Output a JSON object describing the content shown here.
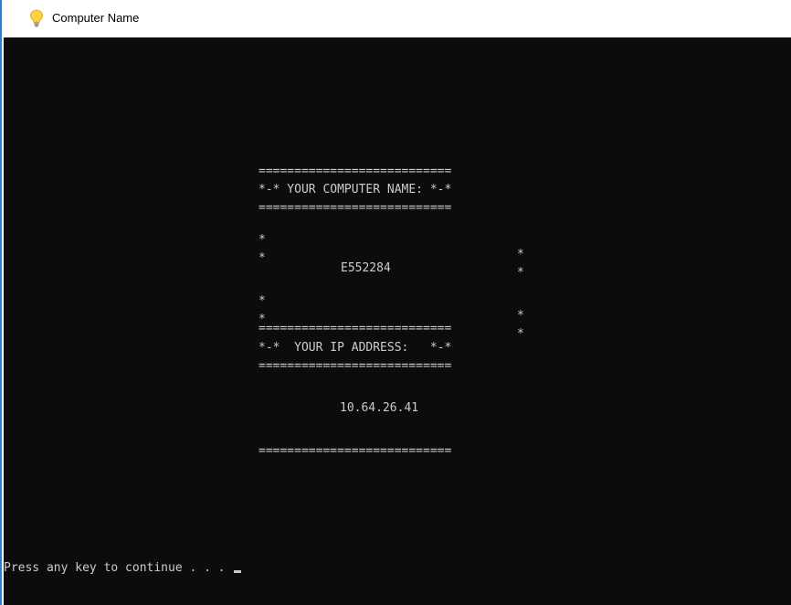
{
  "window": {
    "title": "Computer Name",
    "icon": "lightbulb-icon",
    "accent": "#2b7fd6"
  },
  "console": {
    "background": "#0c0c0c",
    "foreground": "#cccccc",
    "separator": "===========================",
    "name_heading": "*-* YOUR COMPUTER NAME: *-*",
    "star": "*",
    "computer_name": "E552284",
    "ip_heading": "*-*  YOUR IP ADDRESS:   *-*",
    "ip_address": "10.64.26.41",
    "prompt": "Press any key to continue . . ."
  }
}
